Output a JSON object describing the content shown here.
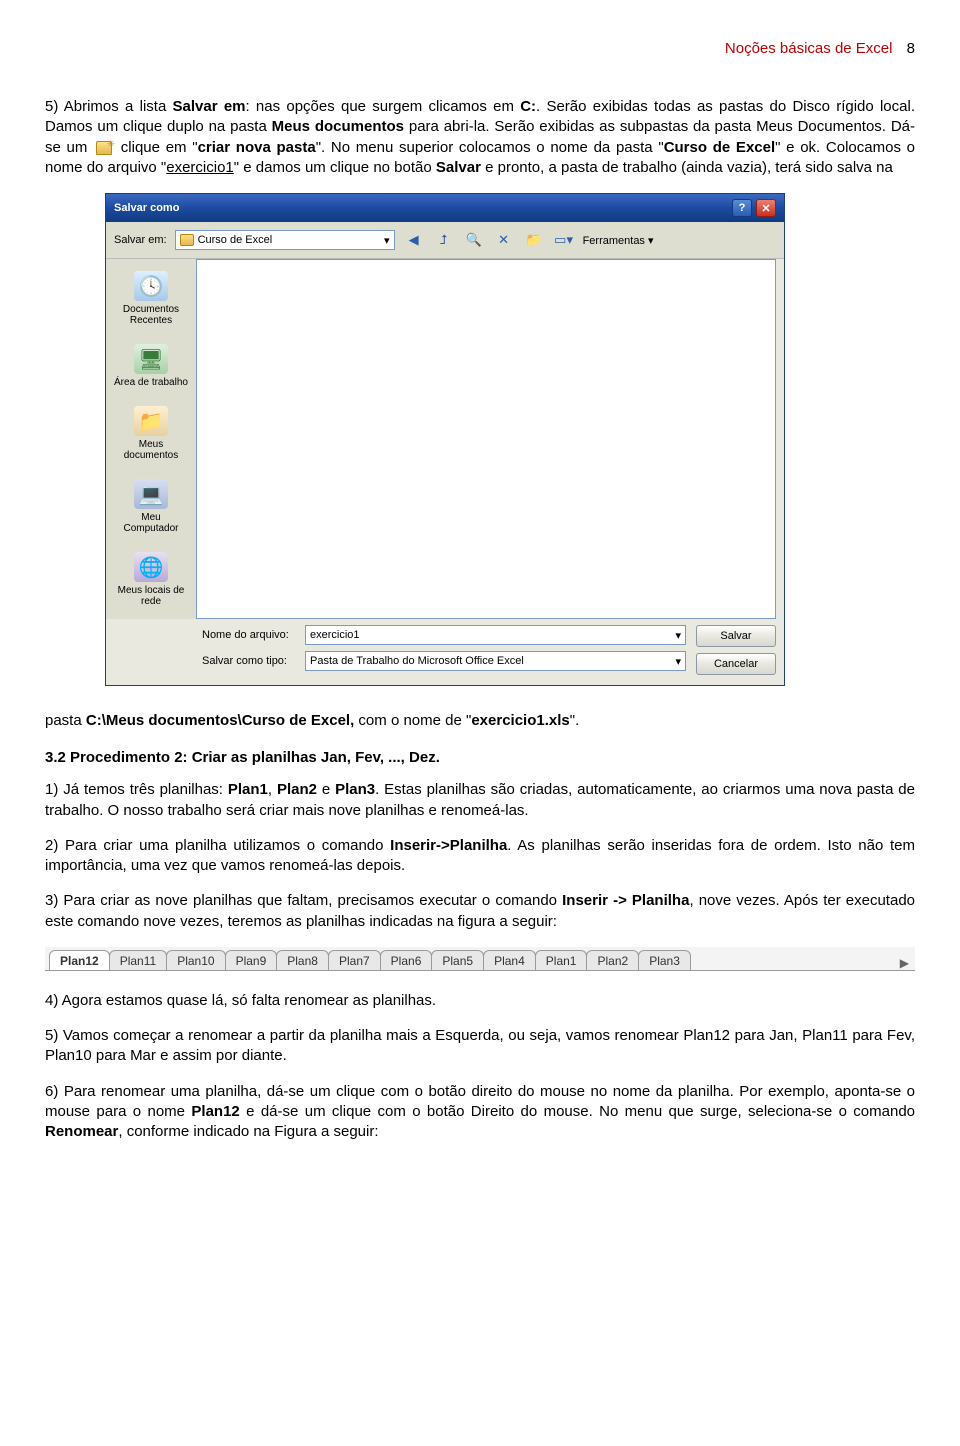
{
  "header": {
    "title": "Noções básicas de Excel",
    "page": "8"
  },
  "p1": {
    "t1": "5) Abrimos a lista ",
    "b1": "Salvar em",
    "t2": ": nas opções que surgem clicamos em ",
    "b2": "C:",
    "t3": ". Serão exibidas todas as pastas do Disco rígido local. Damos um clique duplo na pasta ",
    "b3": "Meus documentos",
    "t4": " para abri-la. Serão exibidas as subpastas da pasta Meus Documentos. Dá-se um ",
    "t5": " clique em \"",
    "b4": "criar nova pasta",
    "t6": "\". No menu superior colocamos o nome da pasta \"",
    "b5": "Curso de Excel",
    "t7": "\" e ok. Colocamos o nome do arquivo \"",
    "u1": "exercicio1",
    "t8": "\" e damos um clique no botão ",
    "b6": "Salvar",
    "t9": " e pronto, a pasta de trabalho (ainda vazia), terá sido salva na"
  },
  "dialog": {
    "title": "Salvar como",
    "savein_label": "Salvar em:",
    "folder": "Curso de Excel",
    "tools": "Ferramentas",
    "places": [
      {
        "icon": "clock",
        "label": "Documentos Recentes"
      },
      {
        "icon": "desktop",
        "label": "Área de trabalho"
      },
      {
        "icon": "docs",
        "label": "Meus documentos"
      },
      {
        "icon": "pc",
        "label": "Meu Computador"
      },
      {
        "icon": "net",
        "label": "Meus locais de rede"
      }
    ],
    "filename_label": "Nome do arquivo:",
    "filename": "exercicio1",
    "filetype_label": "Salvar como tipo:",
    "filetype": "Pasta de Trabalho do Microsoft Office Excel",
    "save": "Salvar",
    "cancel": "Cancelar"
  },
  "p2": {
    "t1": "pasta ",
    "b1": "C:\\Meus documentos\\Curso de Excel,",
    "t2": " com o nome de \"",
    "b2": "exercicio1.xls",
    "t3": "\"."
  },
  "h2": "3.2 Procedimento 2: Criar as planilhas Jan, Fev, ..., Dez.",
  "p3": {
    "t1": "1) Já temos três planilhas: ",
    "b1": "Plan1",
    "t2": ", ",
    "b2": "Plan2",
    "t3": " e ",
    "b3": "Plan3",
    "t4": ". Estas planilhas são criadas, automaticamente, ao criarmos uma nova pasta de trabalho. O nosso trabalho será criar mais nove planilhas e renomeá-las."
  },
  "p4": {
    "t1": "2) Para criar uma planilha utilizamos o comando ",
    "b1": "Inserir->Planilha",
    "t2": ". As planilhas serão inseridas fora de ordem. Isto não tem importância, uma vez que vamos renomeá-las depois."
  },
  "p5": {
    "t1": "3) Para criar as nove planilhas que faltam, precisamos executar o comando ",
    "b1": "Inserir -> Planilha",
    "t2": ", nove vezes. Após ter executado este comando nove vezes, teremos as planilhas indicadas na figura a seguir:"
  },
  "tabs": [
    "Plan12",
    "Plan11",
    "Plan10",
    "Plan9",
    "Plan8",
    "Plan7",
    "Plan6",
    "Plan5",
    "Plan4",
    "Plan1",
    "Plan2",
    "Plan3"
  ],
  "p6": "4) Agora estamos quase lá, só falta renomear as planilhas.",
  "p7": "5) Vamos começar a renomear a partir da planilha mais a Esquerda, ou seja, vamos renomear Plan12 para Jan, Plan11 para Fev, Plan10 para Mar e assim por diante.",
  "p8": {
    "t1": "6) Para renomear uma planilha, dá-se um clique com o botão direito do mouse no nome da planilha. Por exemplo, aponta-se o mouse para o nome ",
    "b1": "Plan12",
    "t2": " e dá-se um clique com o botão Direito do mouse. No menu que surge, seleciona-se o comando ",
    "b2": "Renomear",
    "t3": ", conforme indicado na Figura a seguir:"
  }
}
